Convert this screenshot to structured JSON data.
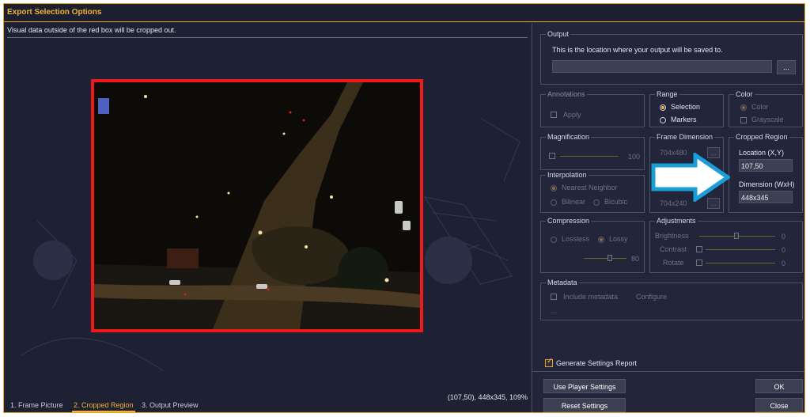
{
  "window": {
    "title": "Export Selection Options"
  },
  "preview": {
    "hint": "Visual data outside of the red box will be cropped out.",
    "status": "(107,50), 448x345, 109%"
  },
  "tabs": [
    {
      "label": "1. Frame Picture"
    },
    {
      "label": "2. Cropped Region"
    },
    {
      "label": "3. Output Preview"
    }
  ],
  "output": {
    "label": "Output",
    "description": "This is the location where your output will be saved to.",
    "path_value": "",
    "browse_label": "..."
  },
  "annotations": {
    "label": "Annotations",
    "apply_label": "Apply"
  },
  "range": {
    "label": "Range",
    "options": [
      "Selection",
      "Markers"
    ],
    "selected": "Selection"
  },
  "color": {
    "label": "Color",
    "options": [
      "Color",
      "Grayscale"
    ],
    "selected": "Color"
  },
  "magnification": {
    "label": "Magnification",
    "value": "100"
  },
  "frame_dimension": {
    "label": "Frame Dimension",
    "value1": "704x480",
    "value2": "704x240",
    "more_label": "..."
  },
  "cropped_region": {
    "label": "Cropped Region",
    "location_label": "Location (X,Y)",
    "location_value": "107,50",
    "dimension_label": "Dimension (WxH)",
    "dimension_value": "448x345"
  },
  "interpolation": {
    "label": "Interpolation",
    "options": [
      "Nearest Neighbor",
      "Bilinear",
      "Bicubic"
    ],
    "selected": "Nearest Neighbor"
  },
  "compression": {
    "label": "Compression",
    "options": [
      "Lossless",
      "Lossy"
    ],
    "selected": "Lossy",
    "quality_value": "80"
  },
  "adjustments": {
    "label": "Adjustments",
    "brightness": {
      "label": "Brightness",
      "value": "0"
    },
    "contrast": {
      "label": "Contrast",
      "value": "0"
    },
    "rotate": {
      "label": "Rotate",
      "value": "0"
    }
  },
  "metadata": {
    "label": "Metadata",
    "include_label": "Include metadata",
    "configure_label": "Configure",
    "ellipsis": "..."
  },
  "report": {
    "label": "Generate Settings Report",
    "checked": true
  },
  "buttons": {
    "use_player_settings": "Use Player Settings",
    "reset_settings": "Reset Settings",
    "ok": "OK",
    "close": "Close"
  },
  "colors": {
    "accent": "#f2b233",
    "crop_box": "#ee1a1a",
    "arrow_fill": "#ffffff",
    "arrow_border": "#1a9fd8",
    "bg": "#23263a"
  }
}
